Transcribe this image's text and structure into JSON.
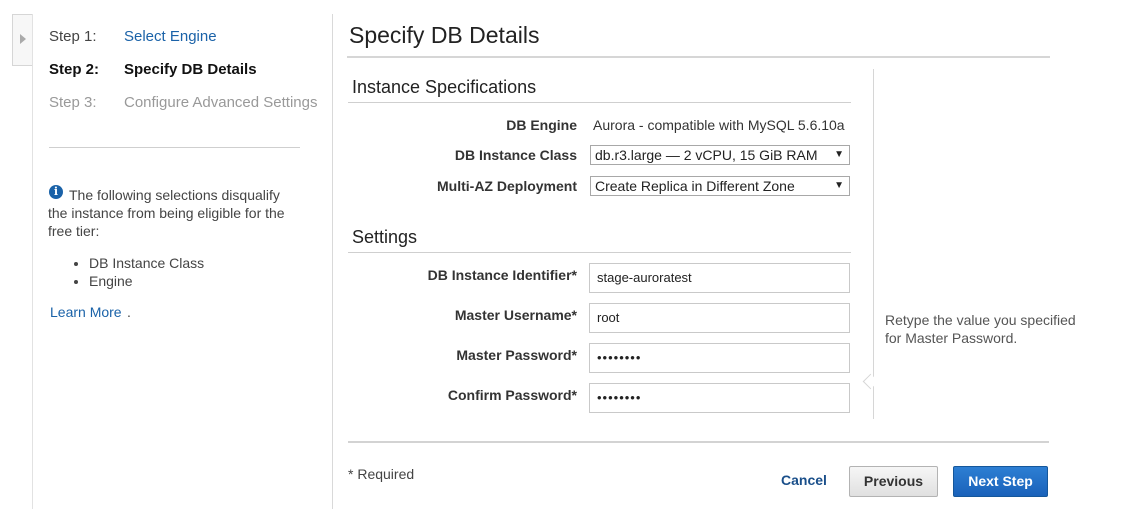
{
  "sidebar": {
    "steps": [
      {
        "num": "Step 1:",
        "label": "Select Engine"
      },
      {
        "num": "Step 2:",
        "label": "Specify DB Details"
      },
      {
        "num": "Step 3:",
        "label": "Configure Advanced Settings"
      }
    ],
    "info_text": "The following selections disqualify the instance from being eligible for the free tier:",
    "disqualifiers": [
      "DB Instance Class",
      "Engine"
    ],
    "learn_more": "Learn More",
    "learn_more_suffix": "."
  },
  "main": {
    "title": "Specify DB Details",
    "instance_spec": {
      "title": "Instance Specifications",
      "db_engine_label": "DB Engine",
      "db_engine_value": "Aurora - compatible with MySQL 5.6.10a",
      "instance_class_label": "DB Instance Class",
      "instance_class_value": "db.r3.large — 2 vCPU, 15 GiB RAM",
      "multi_az_label": "Multi-AZ Deployment",
      "multi_az_value": "Create Replica in Different Zone"
    },
    "settings": {
      "title": "Settings",
      "identifier_label": "DB Instance Identifier*",
      "identifier_value": "stage-auroratest",
      "username_label": "Master Username*",
      "username_value": "root",
      "password_label": "Master Password*",
      "password_value": "••••••••",
      "confirm_label": "Confirm Password*",
      "confirm_value": "••••••••"
    },
    "help_text": "Retype the value you specified for Master Password.",
    "required_note": "* Required"
  },
  "footer": {
    "cancel": "Cancel",
    "previous": "Previous",
    "next": "Next Step"
  },
  "colors": {
    "link": "#1a62a8",
    "primary_button": "#1a62ba"
  },
  "icons": {
    "collapse": "chevron-right-icon",
    "info": "info-icon",
    "dropdown": "triangle-down-icon"
  }
}
